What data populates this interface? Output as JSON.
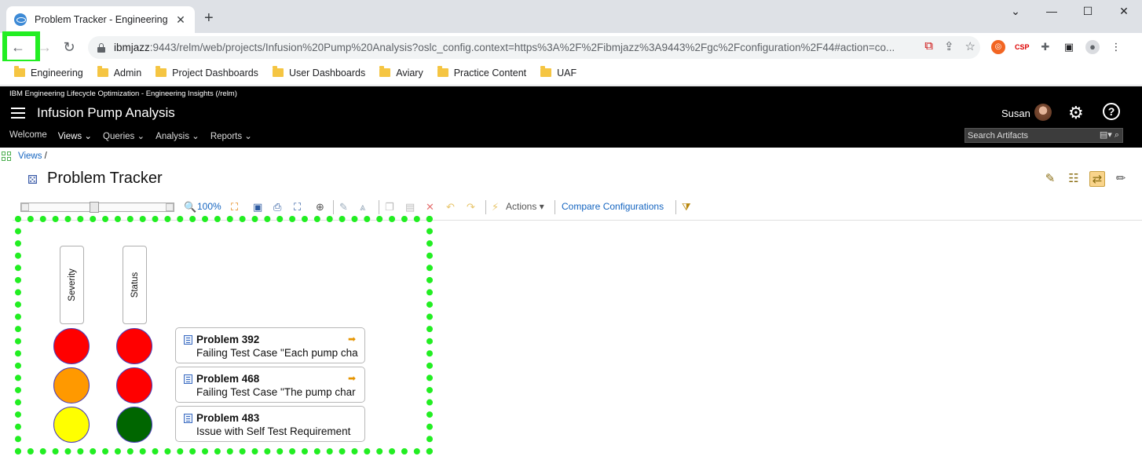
{
  "browser": {
    "tab_title": "Problem Tracker - Engineering In",
    "url_host": "ibmjazz",
    "url_rest": ":9443/relm/web/projects/Infusion%20Pump%20Analysis?oslc_config.context=https%3A%2F%2Fibmjazz%3A9443%2Fgc%2Fconfiguration%2F44#action=co...",
    "bookmarks": [
      "Engineering",
      "Admin",
      "Project Dashboards",
      "User Dashboards",
      "Aviary",
      "Practice Content",
      "UAF"
    ]
  },
  "app": {
    "subtitle": "IBM Engineering Lifecycle Optimization - Engineering Insights (/relm)",
    "project": "Infusion Pump Analysis",
    "user": "Susan",
    "menu": [
      "Welcome",
      "Views",
      "Queries",
      "Analysis",
      "Reports"
    ],
    "search_placeholder": "Search Artifacts"
  },
  "page": {
    "breadcrumb": "Views",
    "breadcrumb_sep": "/",
    "title": "Problem Tracker"
  },
  "diagram_toolbar": {
    "zoom": "100%",
    "actions": "Actions",
    "compare": "Compare Configurations"
  },
  "diagram": {
    "columns": [
      "Severity",
      "Status"
    ],
    "rows": [
      {
        "title": "Problem 392",
        "desc": "Failing Test Case \"Each pump cha",
        "severity_color": "#ff0000",
        "status_color": "#ff0000",
        "link": true
      },
      {
        "title": "Problem 468",
        "desc": "Failing Test Case \"The pump char",
        "severity_color": "#ff9900",
        "status_color": "#ff0000",
        "link": true
      },
      {
        "title": "Problem 483",
        "desc": "Issue with Self Test Requirement",
        "severity_color": "#ffff00",
        "status_color": "#006600",
        "link": false
      }
    ]
  }
}
